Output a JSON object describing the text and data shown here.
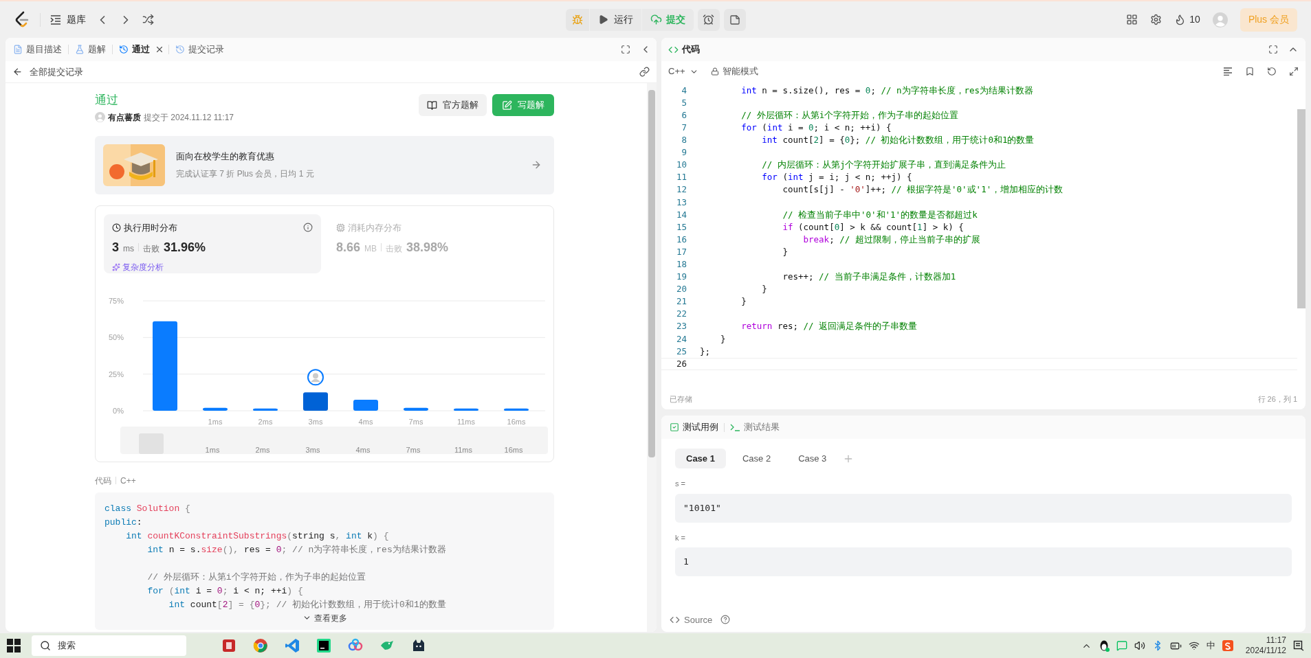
{
  "top_bar": {
    "problem_bank": "题库",
    "run_button": "运行",
    "submit_button": "提交",
    "streak": "10",
    "plus_button": "Plus 会员"
  },
  "left_panel": {
    "tabs": [
      {
        "kind": "description",
        "label": "题目描述",
        "selected": false,
        "closable": false
      },
      {
        "kind": "solution",
        "label": "题解",
        "selected": false,
        "closable": false
      },
      {
        "kind": "history",
        "label": "通过",
        "selected": true,
        "closable": true
      },
      {
        "kind": "history",
        "label": "提交记录",
        "selected": false,
        "closable": false
      }
    ],
    "back_link": "全部提交记录",
    "result": {
      "status": "通过",
      "user": "有点蕃质",
      "submitted": "提交于 2024.11.12 11:17",
      "official_button": "官方题解",
      "write_button": "写题解"
    },
    "promo": {
      "title": "面向在校学生的教育优惠",
      "subtitle": "完成认证享 7 折 Plus 会员，日均 1 元"
    },
    "stats": [
      {
        "kind": "runtime",
        "title": "执行用时分布",
        "value": "3",
        "unit": "ms",
        "beat_label": "击败",
        "beat": "31.96%",
        "link": "复杂度分析",
        "selected": true
      },
      {
        "kind": "memory",
        "title": "消耗内存分布",
        "value": "8.66",
        "unit": "MB",
        "beat_label": "击败",
        "beat": "38.98%",
        "selected": false
      }
    ],
    "chart_data": {
      "type": "bar",
      "categories": [
        null,
        "1ms",
        "2ms",
        "3ms",
        "4ms",
        "7ms",
        "11ms",
        "16ms"
      ],
      "values": [
        61,
        2,
        1.5,
        12.5,
        7.5,
        2,
        1.5,
        1.5
      ],
      "ylim": [
        0,
        75
      ],
      "yticks": [
        {
          "value": 0,
          "label": "0%"
        },
        {
          "value": 25,
          "label": "25%"
        },
        {
          "value": 50,
          "label": "50%"
        },
        {
          "value": 75,
          "label": "75%"
        }
      ]
    },
    "bars": [
      {
        "selected": false
      },
      {
        "selected": false
      },
      {
        "selected": false
      },
      {
        "selected": true
      },
      {
        "selected": false
      },
      {
        "selected": false
      },
      {
        "selected": false
      },
      {
        "selected": false
      }
    ],
    "overview_labels": [
      "1ms",
      "2ms",
      "3ms",
      "4ms",
      "7ms",
      "11ms",
      "16ms"
    ],
    "code_label": "代码",
    "code_language": "C++",
    "code_lines": [
      {
        "kind": "code",
        "tokens": [
          {
            "kind": "keyword",
            "text": "class"
          },
          {
            "kind": "name",
            "text": " Solution"
          },
          {
            "kind": "punct",
            "text": " {"
          }
        ]
      },
      {
        "kind": "code",
        "tokens": [
          {
            "kind": "keyword",
            "text": "public"
          },
          {
            "kind": "plain",
            "text": ":"
          }
        ]
      },
      {
        "kind": "code",
        "tokens": [
          {
            "kind": "keyword",
            "text": "    int"
          },
          {
            "kind": "name",
            "text": " countKConstraintSubstrings"
          },
          {
            "kind": "punct",
            "text": "("
          },
          {
            "kind": "plain",
            "text": "string s"
          },
          {
            "kind": "punct",
            "text": ", "
          },
          {
            "kind": "keyword",
            "text": "int"
          },
          {
            "kind": "plain",
            "text": " k"
          },
          {
            "kind": "punct",
            "text": ") {"
          }
        ]
      },
      {
        "kind": "code",
        "tokens": [
          {
            "kind": "keyword",
            "text": "        int"
          },
          {
            "kind": "plain",
            "text": " n = s."
          },
          {
            "kind": "name",
            "text": "size"
          },
          {
            "kind": "punct",
            "text": "(), "
          },
          {
            "kind": "plain",
            "text": "res = "
          },
          {
            "kind": "number",
            "text": "0"
          },
          {
            "kind": "punct",
            "text": "; "
          },
          {
            "kind": "comment",
            "text": "// n为字符串长度，res为结果计数器"
          }
        ]
      },
      {
        "kind": "blank"
      },
      {
        "kind": "code",
        "tokens": [
          {
            "kind": "comment",
            "text": "        // 外层循环：从第i个字符开始，作为子串的起始位置"
          }
        ]
      },
      {
        "kind": "code",
        "tokens": [
          {
            "kind": "keyword",
            "text": "        for"
          },
          {
            "kind": "punct",
            "text": " ("
          },
          {
            "kind": "keyword",
            "text": "int"
          },
          {
            "kind": "plain",
            "text": " i = "
          },
          {
            "kind": "number",
            "text": "0"
          },
          {
            "kind": "punct",
            "text": "; "
          },
          {
            "kind": "plain",
            "text": "i < n; ++i"
          },
          {
            "kind": "punct",
            "text": ") {"
          }
        ]
      },
      {
        "kind": "code",
        "tokens": [
          {
            "kind": "keyword",
            "text": "            int"
          },
          {
            "kind": "plain",
            "text": " count"
          },
          {
            "kind": "punct",
            "text": "["
          },
          {
            "kind": "number",
            "text": "2"
          },
          {
            "kind": "punct",
            "text": "] = {"
          },
          {
            "kind": "number",
            "text": "0"
          },
          {
            "kind": "punct",
            "text": "}; "
          },
          {
            "kind": "comment",
            "text": "// 初始化计数数组，用于统计0和1的数量"
          }
        ]
      }
    ],
    "more_button": "查看更多"
  },
  "editor": {
    "title": "代码",
    "language": "C++",
    "mode": "智能模式",
    "lines": [
      {
        "number": "4",
        "current": false,
        "tokens": [
          {
            "kind": "type",
            "text": "        int"
          },
          {
            "kind": "plain",
            "text": " n = s.size(), res = "
          },
          {
            "kind": "number",
            "text": "0"
          },
          {
            "kind": "plain",
            "text": "; "
          },
          {
            "kind": "comment",
            "text": "// n为字符串长度，res为结果计数器"
          }
        ]
      },
      {
        "number": "5",
        "current": false
      },
      {
        "number": "6",
        "current": false,
        "tokens": [
          {
            "kind": "comment",
            "text": "        // 外层循环：从第i个字符开始，作为子串的起始位置"
          }
        ]
      },
      {
        "number": "7",
        "current": false,
        "tokens": [
          {
            "kind": "type",
            "text": "        for"
          },
          {
            "kind": "plain",
            "text": " ("
          },
          {
            "kind": "type",
            "text": "int"
          },
          {
            "kind": "plain",
            "text": " i = "
          },
          {
            "kind": "number",
            "text": "0"
          },
          {
            "kind": "plain",
            "text": "; i < n; ++i) {"
          }
        ]
      },
      {
        "number": "8",
        "current": false,
        "tokens": [
          {
            "kind": "type",
            "text": "            int"
          },
          {
            "kind": "plain",
            "text": " count["
          },
          {
            "kind": "number",
            "text": "2"
          },
          {
            "kind": "plain",
            "text": "] = {"
          },
          {
            "kind": "number",
            "text": "0"
          },
          {
            "kind": "plain",
            "text": "}; "
          },
          {
            "kind": "comment",
            "text": "// 初始化计数数组，用于统计0和1的数量"
          }
        ]
      },
      {
        "number": "9",
        "current": false
      },
      {
        "number": "10",
        "current": false,
        "tokens": [
          {
            "kind": "comment",
            "text": "            // 内层循环：从第j个字符开始扩展子串，直到满足条件为止"
          }
        ]
      },
      {
        "number": "11",
        "current": false,
        "tokens": [
          {
            "kind": "type",
            "text": "            for"
          },
          {
            "kind": "plain",
            "text": " ("
          },
          {
            "kind": "type",
            "text": "int"
          },
          {
            "kind": "plain",
            "text": " j = i; j < n; ++j) {"
          }
        ]
      },
      {
        "number": "12",
        "current": false,
        "tokens": [
          {
            "kind": "plain",
            "text": "                count[s[j] - "
          },
          {
            "kind": "string",
            "text": "'0'"
          },
          {
            "kind": "plain",
            "text": "]++; "
          },
          {
            "kind": "comment",
            "text": "// 根据字符是'0'或'1'，增加相应的计数"
          }
        ]
      },
      {
        "number": "13",
        "current": false
      },
      {
        "number": "14",
        "current": false,
        "tokens": [
          {
            "kind": "comment",
            "text": "                // 检查当前子串中'0'和'1'的数量是否都超过k"
          }
        ]
      },
      {
        "number": "15",
        "current": false,
        "tokens": [
          {
            "kind": "control",
            "text": "                if"
          },
          {
            "kind": "plain",
            "text": " (count["
          },
          {
            "kind": "number",
            "text": "0"
          },
          {
            "kind": "plain",
            "text": "] > k && count["
          },
          {
            "kind": "number",
            "text": "1"
          },
          {
            "kind": "plain",
            "text": "] > k) {"
          }
        ]
      },
      {
        "number": "16",
        "current": false,
        "tokens": [
          {
            "kind": "control",
            "text": "                    break"
          },
          {
            "kind": "plain",
            "text": "; "
          },
          {
            "kind": "comment",
            "text": "// 超过限制，停止当前子串的扩展"
          }
        ]
      },
      {
        "number": "17",
        "current": false,
        "tokens": [
          {
            "kind": "plain",
            "text": "                }"
          }
        ]
      },
      {
        "number": "18",
        "current": false
      },
      {
        "number": "19",
        "current": false,
        "tokens": [
          {
            "kind": "plain",
            "text": "                res++; "
          },
          {
            "kind": "comment",
            "text": "// 当前子串满足条件，计数器加1"
          }
        ]
      },
      {
        "number": "20",
        "current": false,
        "tokens": [
          {
            "kind": "plain",
            "text": "            }"
          }
        ]
      },
      {
        "number": "21",
        "current": false,
        "tokens": [
          {
            "kind": "plain",
            "text": "        }"
          }
        ]
      },
      {
        "number": "22",
        "current": false
      },
      {
        "number": "23",
        "current": false,
        "tokens": [
          {
            "kind": "control",
            "text": "        return"
          },
          {
            "kind": "plain",
            "text": " res; "
          },
          {
            "kind": "comment",
            "text": "// 返回满足条件的子串数量"
          }
        ]
      },
      {
        "number": "24",
        "current": false,
        "tokens": [
          {
            "kind": "plain",
            "text": "    }"
          }
        ]
      },
      {
        "number": "25",
        "current": false,
        "tokens": [
          {
            "kind": "plain",
            "text": "};"
          }
        ]
      },
      {
        "number": "26",
        "current": true
      }
    ],
    "saved": "已存储",
    "cursor": "行 26，列 1"
  },
  "test_panel": {
    "tabs": [
      {
        "kind": "cases",
        "label": "测试用例",
        "selected": true
      },
      {
        "kind": "result",
        "label": "测试结果",
        "selected": false
      }
    ],
    "cases": [
      {
        "label": "Case 1",
        "selected": true
      },
      {
        "label": "Case 2",
        "selected": false
      },
      {
        "label": "Case 3",
        "selected": false
      }
    ],
    "inputs": [
      {
        "label": "s =",
        "value": "\"10101\""
      },
      {
        "label": "k =",
        "value": "1"
      }
    ],
    "source_link": "Source"
  },
  "taskbar": {
    "search_placeholder": "搜索",
    "ime": "中",
    "time": "11:17",
    "date": "2024/11/12"
  }
}
